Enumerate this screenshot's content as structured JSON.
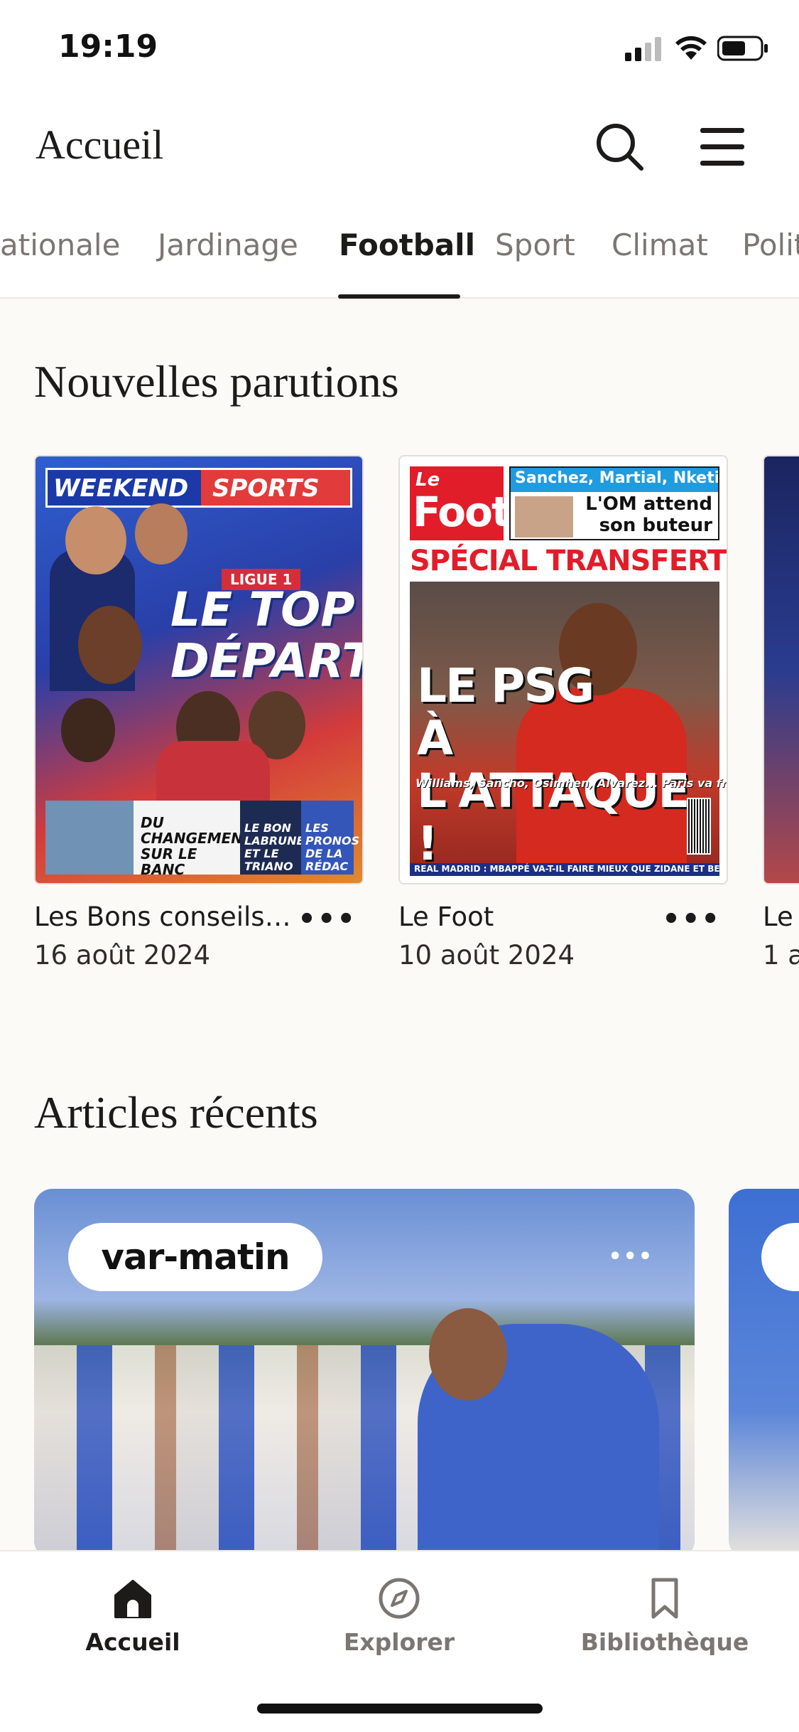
{
  "status_bar": {
    "time": "19:19"
  },
  "header": {
    "title": "Accueil"
  },
  "tabs": [
    {
      "label": "ationale"
    },
    {
      "label": "Jardinage"
    },
    {
      "label": "Football",
      "active": true
    },
    {
      "label": "Sport"
    },
    {
      "label": "Climat"
    },
    {
      "label": "Politi"
    }
  ],
  "sections": {
    "new_issues_title": "Nouvelles parutions",
    "recent_articles_title": "Articles récents"
  },
  "magazines": [
    {
      "name": "Les Bons conseils…",
      "date": "16 août 2024",
      "cover": {
        "masthead_left": "WEEKEND",
        "masthead_right": "SPORTS",
        "badge": "LIGUE 1",
        "headline_line1": "LE TOP",
        "headline_line2": "DÉPART",
        "box1": "DU CHANGEMENT SUR LE BANC",
        "box2": "LE BON LABRUNE ET LE TRIANO",
        "box3": "LES PRONOS DE LA RÉDAC"
      }
    },
    {
      "name": "Le Foot",
      "date": "10 août 2024",
      "cover": {
        "logo_small": "Le",
        "logo_big": "Foot",
        "top_bar": "Sanchez, Martial, Nketiah...",
        "om_line1": "L'OM attend",
        "om_line2": "son buteur",
        "special": "SPÉCIAL TRANSFERTS",
        "headline_line1": "LE PSG",
        "headline_line2": "À L'ATTAQUE !",
        "subline": "Williams, Sancho, Osimhen, Alvarez... Paris va frapper fort !",
        "bottom_strip": "REAL MADRID : MBAPPÉ VA-T-IL FAIRE MIEUX QUE ZIDANE ET BENZEMA ?"
      }
    },
    {
      "name": "Le",
      "date": "1 a"
    }
  ],
  "articles": [
    {
      "source": "var-matin"
    }
  ],
  "bottom_nav": [
    {
      "label": "Accueil",
      "icon": "home-icon",
      "active": true
    },
    {
      "label": "Explorer",
      "icon": "compass-icon"
    },
    {
      "label": "Bibliothèque",
      "icon": "bookmark-icon"
    }
  ]
}
